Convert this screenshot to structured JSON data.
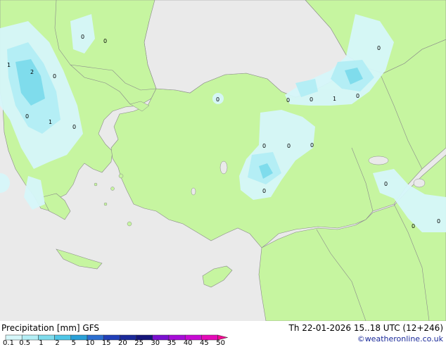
{
  "footer": {
    "title": "Precipitation [mm]",
    "model": "GFS",
    "valid_time": "Th 22-01-2026 15..18 UTC (12+246)",
    "credit": "©weatheronline.co.uk"
  },
  "scale": {
    "ticks": [
      "0.1",
      "0.5",
      "1",
      "2",
      "5",
      "10",
      "15",
      "20",
      "25",
      "30",
      "35",
      "40",
      "45",
      "50"
    ],
    "colors": [
      "#d6f7fa",
      "#b4eef5",
      "#7fdcec",
      "#4fc6e6",
      "#2aa0d8",
      "#2c6ed0",
      "#213fb8",
      "#1b2a9a",
      "#15157a",
      "#7a10d0",
      "#a60cd8",
      "#c80ad4",
      "#e40ab8",
      "#f00a90"
    ]
  },
  "map": {
    "land_color": "#c6f5a0",
    "sea_color": "#eaeaea",
    "rain_light_color": "#d6f7fa",
    "rain_medium_color": "#b4eef5",
    "rain_heavy_color": "#7fdcec",
    "rain_max_color": "#4fc6e6",
    "labels": [
      "1",
      "2",
      "0",
      "0",
      "0",
      "1",
      "0",
      "0",
      "0",
      "0",
      "0",
      "1",
      "0",
      "0",
      "0",
      "0",
      "0",
      "0",
      "0",
      "0",
      "0",
      "0"
    ]
  }
}
